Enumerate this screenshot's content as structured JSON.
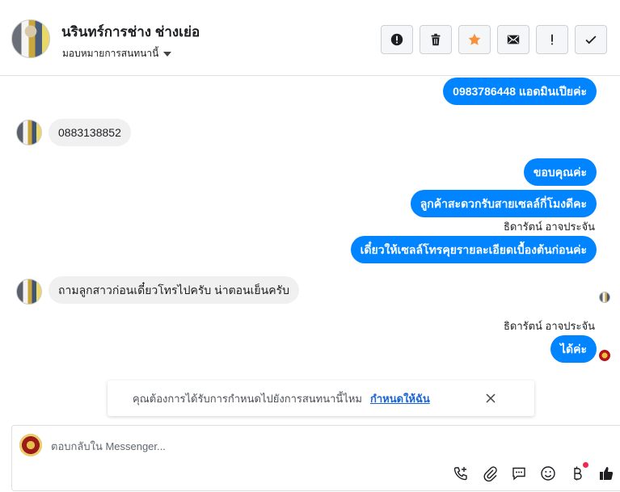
{
  "header": {
    "contact_name": "นรินทร์การช่าง ช่างเย่อ",
    "assign_label": "มอบหมายการสนทนานี้",
    "actions": [
      {
        "name": "report-spam-button",
        "icon": "alert-circle-icon"
      },
      {
        "name": "delete-button",
        "icon": "trash-icon"
      },
      {
        "name": "star-button",
        "icon": "star-icon"
      },
      {
        "name": "mark-unread-button",
        "icon": "envelope-icon"
      },
      {
        "name": "follow-up-button",
        "icon": "exclamation-icon"
      },
      {
        "name": "mark-done-button",
        "icon": "check-icon"
      }
    ]
  },
  "messages": [
    {
      "dir": "out",
      "text": "0983786448 แอดมินเปียค่ะ"
    },
    {
      "dir": "in",
      "text": "0883138852"
    },
    {
      "dir": "out",
      "text": "ขอบคุณค่ะ"
    },
    {
      "dir": "out",
      "text": "ลูกค้าสะดวกรับสายเซลล์กี่โมงดีคะ"
    },
    {
      "dir": "sender",
      "text": "ธิดารัตน์ อาจประจัน"
    },
    {
      "dir": "out",
      "text": "เดี๋ยวให้เซลล์โทรคุยรายละเอียดเบื้องต้นก่อนค่ะ"
    },
    {
      "dir": "in",
      "text": "ถามลูกสาวก่อนเดี๋ยวโทรไปครับ น่าตอนเย็นครับ"
    },
    {
      "dir": "sender",
      "text": "ธิดารัตน์ อาจประจัน"
    },
    {
      "dir": "out",
      "text": "ได้ค่ะ"
    }
  ],
  "assign_prompt": {
    "text": "คุณต้องการได้รับการกำหนดไปยังการสนทนานี้ไหม",
    "link": "กำหนดให้ฉัน"
  },
  "composer": {
    "placeholder": "ตอบกลับใน Messenger...",
    "tools": [
      "call-add-icon",
      "paperclip-icon",
      "saved-reply-icon",
      "emoji-icon",
      "payment-icon",
      "like-icon"
    ]
  },
  "colors": {
    "accent": "#0084ff",
    "incoming_bubble": "#f0f0f0",
    "star": "#f7923a",
    "link": "#1a64d6"
  }
}
